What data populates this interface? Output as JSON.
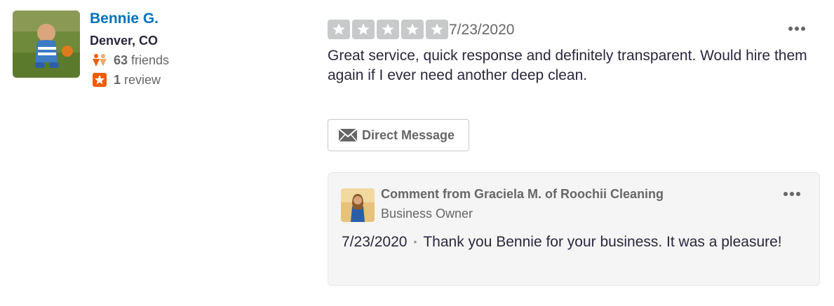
{
  "user": {
    "name": "Bennie G.",
    "location": "Denver, CO",
    "friends_count": "63",
    "friends_label": "friends",
    "reviews_count": "1",
    "reviews_label": "review"
  },
  "review": {
    "rating": 0,
    "rating_max": 5,
    "date": "7/23/2020",
    "text": "Great service, quick response and definitely transparent. Would hire them again if I ever need another deep clean."
  },
  "actions": {
    "direct_message_label": "Direct Message"
  },
  "business_comment": {
    "title": "Comment from Graciela M. of Roochii Cleaning",
    "role": "Business Owner",
    "date": "7/23/2020",
    "separator": "•",
    "text": "Thank you Bennie for your business. It was a pleasure!"
  },
  "colors": {
    "link_blue": "#0073bb",
    "star_empty": "#c8c9ca",
    "friends_icon": "#f15c00",
    "review_icon": "#f15c00",
    "comment_bg": "#f5f5f5"
  },
  "icons": {
    "friends": "friends-icon",
    "review": "review-star-icon",
    "message": "mail-icon",
    "more": "more-options-icon"
  }
}
